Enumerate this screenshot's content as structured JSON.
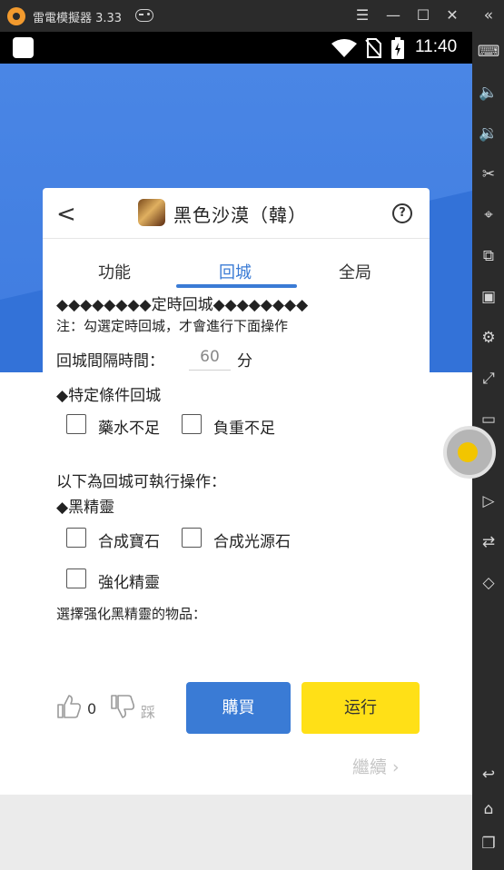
{
  "emulator": {
    "title": "雷電模擬器 3.33",
    "controls": {
      "menu": "☰",
      "minimize": "—",
      "maximize": "☐",
      "close": "✕"
    },
    "sidebar_icons": [
      "collapse-icon",
      "keyboard-icon",
      "volume-up-icon",
      "volume-down-icon",
      "scissors-icon",
      "location-icon",
      "multi-window-icon",
      "apk-install-icon",
      "settings-icon",
      "fullscreen-icon",
      "screen-record-icon",
      "shake-icon",
      "play-icon",
      "sync-icon",
      "rotate-icon",
      "back-icon",
      "home-icon",
      "recents-icon"
    ]
  },
  "statusbar": {
    "time": "11:40"
  },
  "dialog": {
    "back": "<",
    "game_title": "黑色沙漠（韓）",
    "help": "?",
    "tabs": [
      {
        "label": "功能",
        "active": false
      },
      {
        "label": "回城",
        "active": true
      },
      {
        "label": "全局",
        "active": false
      }
    ],
    "section_title": "◆◆◆◆◆◆◆◆定時回城◆◆◆◆◆◆◆◆",
    "note": "注：勾選定時回城，才會進行下面操作",
    "interval_label": "回城間隔時間：",
    "interval_value": "60",
    "interval_unit": "分",
    "condition_title": "◆特定條件回城",
    "condition_options": [
      {
        "label": "藥水不足",
        "checked": false
      },
      {
        "label": "負重不足",
        "checked": false
      }
    ],
    "actions_title": "以下為回城可執行操作：",
    "spirit_title": "◆黑精靈",
    "spirit_options": [
      {
        "label": "合成寶石",
        "checked": false
      },
      {
        "label": "合成光源石",
        "checked": false
      },
      {
        "label": "強化精靈",
        "checked": false
      }
    ],
    "enhance_items_label": "選擇强化黑精靈的物品：",
    "like_count": "0",
    "dislike_label": "踩",
    "buy_label": "購買",
    "run_label": "运行"
  },
  "footer": {
    "next_label": "繼續 ›"
  },
  "colors": {
    "accent": "#3a7bd5",
    "run": "#ffe017",
    "header_blue": "#3f7ce0"
  }
}
